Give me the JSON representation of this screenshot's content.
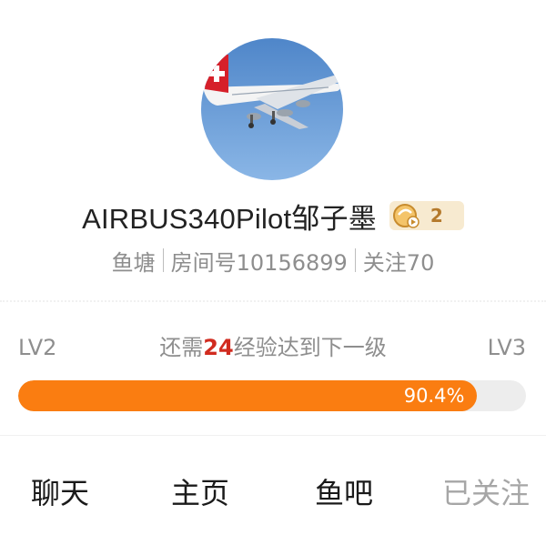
{
  "profile": {
    "username": "AIRBUS340Pilot邹子墨",
    "badge_level": "2",
    "info": {
      "pond_label": "鱼塘",
      "room_label": "房间号10156899",
      "follow_label": "关注70"
    }
  },
  "level": {
    "current": "LV2",
    "next": "LV3",
    "exp_prefix": "还需",
    "exp_needed": "24",
    "exp_suffix": "经验达到下一级",
    "progress_fraction": 0.904,
    "progress_label": "90.4%"
  },
  "colors": {
    "accent": "#fa7d11",
    "exp_number": "#d12b1f",
    "badge_bg": "#f7ead0",
    "badge_text": "#b57a2c"
  },
  "icons": {
    "badge": "fan-badge-icon"
  },
  "nav": {
    "chat": "聊天",
    "home": "主页",
    "fish_bar": "鱼吧",
    "followed": "已关注"
  }
}
